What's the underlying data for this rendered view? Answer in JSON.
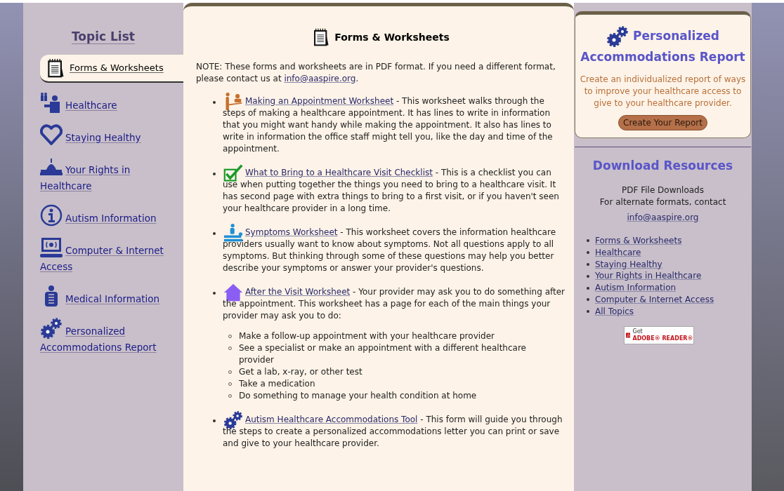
{
  "sidebar": {
    "title": "Topic List",
    "items": [
      {
        "label": "Forms & Worksheets",
        "kind": "notepad",
        "selected": true
      },
      {
        "label": "Healthcare",
        "kind": "people",
        "selected": false
      },
      {
        "label": "Staying Healthy",
        "kind": "heart",
        "selected": false
      },
      {
        "label": "Your Rights in Healthcare",
        "kind": "capitol",
        "selected": false
      },
      {
        "label": "Autism Information",
        "kind": "info",
        "selected": false
      },
      {
        "label": "Computer & Internet Access",
        "kind": "computer",
        "selected": false
      },
      {
        "label": "Medical Information",
        "kind": "body",
        "selected": false
      },
      {
        "label": "Personalized Accommodations Report",
        "kind": "gears",
        "selected": false
      }
    ]
  },
  "main": {
    "title": "Forms & Worksheets",
    "note": "NOTE: These forms and worksheets are in PDF format. If you need a different format, please contact us at ",
    "note_link": "info@aaspire.org",
    "note_end": ".",
    "worksheets": [
      {
        "kind": "appointment",
        "link": "Making an Appointment Worksheet",
        "description": " - This worksheet walks through the steps of making a healthcare appointment. It has lines to write in information that you might want handy while making the appointment. It also has lines to write in information the office staff might tell you, like the day and time of the appointment."
      },
      {
        "kind": "check",
        "link": "What to Bring to a Healthcare Visit Checklist",
        "description": " - This is a checklist you can use when putting together the things you need to bring to a healthcare visit. It has second page with extra things to bring to a first visit, or if you haven't seen your healthcare provider in a long time."
      },
      {
        "kind": "exam",
        "link": "Symptoms Worksheet",
        "description": " - This worksheet covers the information healthcare providers usually want to know about symptoms. Not all questions apply to all symptoms. But thinking through some of these questions may help you better describe your symptoms or answer your provider's questions."
      },
      {
        "kind": "house",
        "link": "After the Visit Worksheet",
        "description": " - Your provider may ask you to do something after the appointment. This worksheet has a page for each of the main things your provider may ask you to do:",
        "subitems": [
          "Make a follow-up appointment with your healthcare provider",
          "See a specialist or make an appointment with a different healthcare provider",
          "Get a lab, x-ray, or other test",
          "Take a medication",
          "Do something to manage your health condition at home"
        ]
      },
      {
        "kind": "gears",
        "link": "Autism Healthcare Accommodations Tool",
        "description": " - This form will guide you through the steps to create a personalized accommodations letter you can print or save and give to your healthcare provider."
      }
    ]
  },
  "report": {
    "title_line1": "Personalized",
    "title_line2": "Accommodations Report",
    "description": "Create an individualized report of ways to improve your healthcare access to give to your healthcare provider.",
    "button": "Create Your Report"
  },
  "downloads": {
    "title": "Download Resources",
    "lines": [
      "PDF File Downloads",
      "For alternate formats, contact"
    ],
    "email": "info@aaspire.org",
    "links": [
      "Forms & Worksheets",
      "Healthcare",
      "Staying Healthy",
      "Your Rights in Healthcare",
      "Autism Information",
      "Computer & Internet Access",
      "All Topics"
    ],
    "badge": {
      "line1": "Get",
      "line2": "ADOBE® READER®"
    }
  }
}
